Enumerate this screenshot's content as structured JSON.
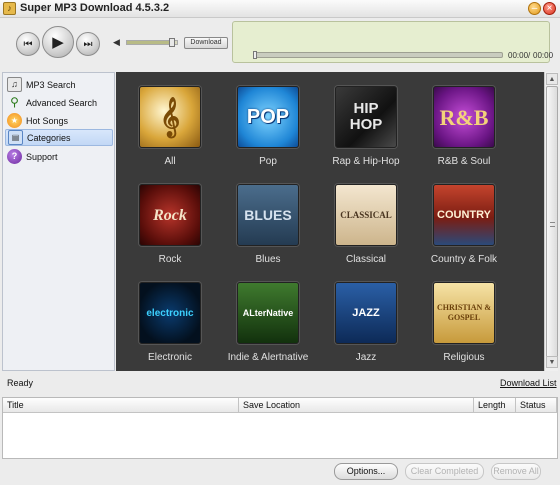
{
  "window": {
    "title": "Super MP3 Download  4.5.3.2",
    "app_icon": "music-note-icon"
  },
  "player": {
    "download_label": "Download",
    "current_time": "00:00",
    "separator": "/",
    "total_time": "00:00",
    "volume_fraction": 0.9,
    "seek_fraction": 0.0
  },
  "sidebar": {
    "items": [
      {
        "label": "MP3 Search",
        "icon": "music-file-icon",
        "glyph": "♫"
      },
      {
        "label": "Advanced Search",
        "icon": "magnifier-icon",
        "glyph": "⚲"
      },
      {
        "label": "Hot Songs",
        "icon": "hot-icon",
        "glyph": "★"
      },
      {
        "label": "Categories",
        "icon": "categories-icon",
        "glyph": "▤"
      },
      {
        "label": "Support",
        "icon": "help-icon",
        "glyph": "?"
      }
    ],
    "active_index": 3
  },
  "categories": [
    {
      "label": "All",
      "cover_text": "",
      "glyph": "𝄞"
    },
    {
      "label": "Pop",
      "cover_text": "POP",
      "glyph": ""
    },
    {
      "label": "Rap & Hip-Hop",
      "cover_text": "HIP HOP",
      "glyph": ""
    },
    {
      "label": "R&B & Soul",
      "cover_text": "R&B",
      "glyph": ""
    },
    {
      "label": "Rock",
      "cover_text": "Rock",
      "glyph": ""
    },
    {
      "label": "Blues",
      "cover_text": "BLUES",
      "glyph": ""
    },
    {
      "label": "Classical",
      "cover_text": "CLASSICAL",
      "glyph": ""
    },
    {
      "label": "Country & Folk",
      "cover_text": "COUNTRY",
      "glyph": ""
    },
    {
      "label": "Electronic",
      "cover_text": "electronic",
      "glyph": ""
    },
    {
      "label": "Indie & Alertnative",
      "cover_text": "ALterNative",
      "glyph": ""
    },
    {
      "label": "Jazz",
      "cover_text": "JAZZ",
      "glyph": ""
    },
    {
      "label": "Religious",
      "cover_text": "CHRISTIAN & GOSPEL",
      "glyph": ""
    }
  ],
  "status": {
    "text": "Ready",
    "download_list_link": "Download List"
  },
  "download_table": {
    "columns": [
      "Title",
      "Save Location",
      "Length",
      "Status"
    ]
  },
  "buttons": {
    "options": "Options...",
    "clear_completed": "Clear Completed",
    "remove_all": "Remove All"
  }
}
